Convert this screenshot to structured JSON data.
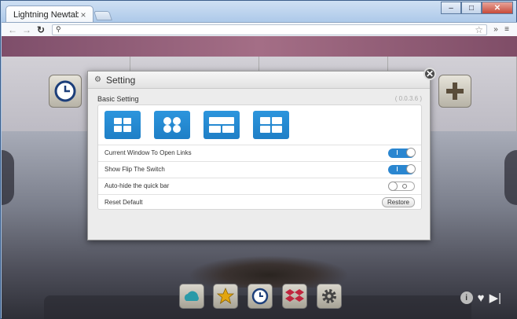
{
  "browser": {
    "tab_title": "Lightning Newtab",
    "tab_close": "×",
    "window_buttons": [
      "–",
      "□",
      "✕"
    ],
    "address_value": "",
    "toolbar_more": "»",
    "menu_icon": "≡"
  },
  "dialog": {
    "title": "Setting",
    "section_title": "Basic Setting",
    "version": "( 0.0.3.6 )",
    "layout_options": [
      "grid-2x2",
      "grid-dots",
      "grid-wide",
      "grid-2x3"
    ],
    "settings": [
      {
        "label": "Current Window To Open Links",
        "control": "toggle",
        "state": "on"
      },
      {
        "label": "Show Flip The Switch",
        "control": "toggle",
        "state": "on"
      },
      {
        "label": "Auto-hide the quick bar",
        "control": "toggle",
        "state": "off"
      },
      {
        "label": "Reset Default",
        "control": "button",
        "button_label": "Restore"
      }
    ],
    "close_glyph": "✕"
  },
  "quick_bar": {
    "icons": [
      "cloud-icon",
      "star-icon",
      "clock-icon",
      "dropbox-icon",
      "gear-icon"
    ],
    "right_icons": [
      "info-icon",
      "heart-icon",
      "next-icon"
    ]
  },
  "colors": {
    "accent_blue": "#2a86d0",
    "toggle_on": "#2a86d0"
  }
}
